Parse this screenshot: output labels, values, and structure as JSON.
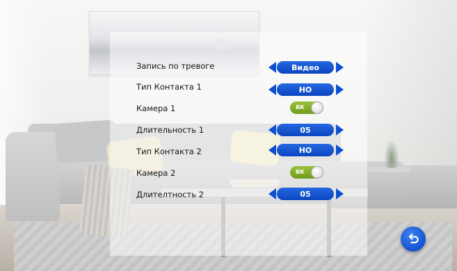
{
  "settings": {
    "rows": [
      {
        "label": "Запись по тревоге",
        "control": "selector",
        "value": "Видео"
      },
      {
        "label": "Тип Контакта 1",
        "control": "selector",
        "value": "НО"
      },
      {
        "label": "Камера 1",
        "control": "toggle",
        "value": "ВК",
        "state": "on"
      },
      {
        "label": "Длительность 1",
        "control": "selector",
        "value": "05"
      },
      {
        "label": "Тип Контакта 2",
        "control": "selector",
        "value": "НО"
      },
      {
        "label": "Камера 2",
        "control": "toggle",
        "value": "ВК",
        "state": "on"
      },
      {
        "label": "Длителтность 2",
        "control": "selector",
        "value": "05"
      }
    ]
  },
  "icons": {
    "selector_left": "arrow-left-icon",
    "selector_right": "arrow-right-icon",
    "back": "back-return-icon"
  },
  "colors": {
    "selector_blue": "#0b45bf",
    "toggle_green": "#7ea722",
    "back_button": "#1452d0"
  }
}
